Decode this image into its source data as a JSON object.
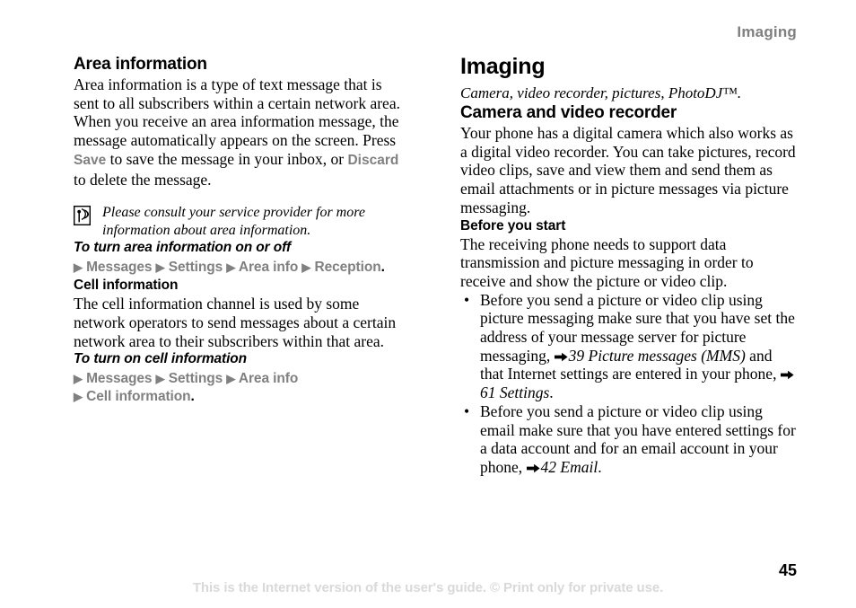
{
  "header": {
    "running_title": "Imaging"
  },
  "left_column": {
    "heading": "Area information",
    "intro_before_save": "Area information is a type of text message that is sent to all subscribers within a certain network area. When you receive an area information message, the message automatically appears on the screen. Press ",
    "ui_save": "Save",
    "intro_middle": " to save the message in your inbox, or ",
    "ui_discard": "Discard",
    "intro_after": " to delete the message.",
    "note": {
      "icon": "area-info-broadcast-icon",
      "text": "Please consult your service provider for more information about area information."
    },
    "procedure_1": {
      "title": "To turn area information on or off",
      "path_line_1": {
        "items": [
          "Messages",
          "Settings",
          "Area info",
          "Reception"
        ],
        "terminator": "."
      }
    },
    "subsection": {
      "title": "Cell information",
      "body": "The cell information channel is used by some network operators to send messages about a certain network area to their subscribers within that area."
    },
    "procedure_2": {
      "title": "To turn on cell information",
      "path_line_1": {
        "items": [
          "Messages",
          "Settings",
          "Area info"
        ]
      },
      "path_line_2": {
        "items": [
          "Cell information"
        ],
        "terminator": "."
      }
    }
  },
  "right_column": {
    "chapter_title": "Imaging",
    "chapter_subtitle": "Camera, video recorder, pictures, PhotoDJ™.",
    "section": {
      "title": "Camera and video recorder",
      "body": "Your phone has a digital camera which also works as a digital video recorder. You can take pictures, record video clips, save and view them and send them as email attachments or in picture messages via picture messaging."
    },
    "before_you_start": {
      "title": "Before you start",
      "body": "The receiving phone needs to support data transmission and picture messaging in order to receive and show the picture or video clip.",
      "bullets": [
        {
          "marker": "•",
          "part_1": "Before you send a picture or video clip using picture messaging make sure that you have set the address of your message server for picture messaging, ",
          "xref_1": "39 Picture messages (MMS)",
          "part_2": " and that Internet settings are entered in your phone, ",
          "xref_2": "61 Settings",
          "part_3": "."
        },
        {
          "marker": "•",
          "part_1": "Before you send a picture or video clip using email make sure that you have entered settings for a data account and for an email account in your phone, ",
          "xref_1": "42 Email",
          "part_2": "."
        }
      ]
    }
  },
  "footer": {
    "note": "This is the Internet version of the user's guide. © Print only for private use.",
    "page_number": "45"
  },
  "colors": {
    "ui_term_gray": "#808080",
    "running_header_gray": "#7f7f7f",
    "footer_gray": "#d9d9d9",
    "text_black": "#000000"
  }
}
